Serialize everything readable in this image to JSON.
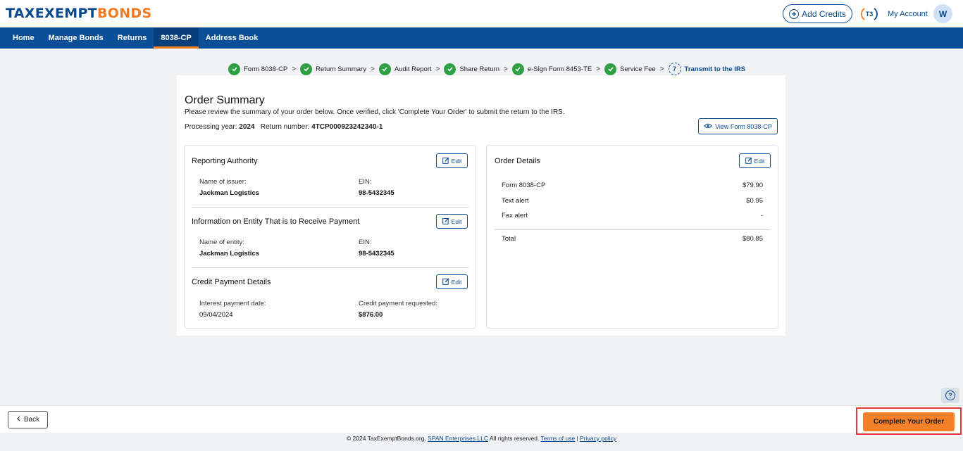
{
  "header": {
    "logo_part1": "TAXEXEMPT",
    "logo_part2": "B",
    "logo_part3": "ONDS",
    "add_credits_label": "Add Credits",
    "t3_label": "T3",
    "my_account_label": "My Account",
    "avatar_initial": "W"
  },
  "nav": {
    "items": [
      {
        "label": "Home"
      },
      {
        "label": "Manage Bonds"
      },
      {
        "label": "Returns"
      },
      {
        "label": "8038-CP"
      },
      {
        "label": "Address Book"
      }
    ]
  },
  "stepper": {
    "steps": [
      {
        "label": "Form 8038-CP",
        "status": "done"
      },
      {
        "label": "Return Summary",
        "status": "done"
      },
      {
        "label": "Audit Report",
        "status": "done"
      },
      {
        "label": "Share Return",
        "status": "done"
      },
      {
        "label": "e-Sign Form 8453-TE",
        "status": "done"
      },
      {
        "label": "Service Fee",
        "status": "done"
      },
      {
        "label": "Transmit to the IRS",
        "status": "current",
        "number": "7"
      }
    ]
  },
  "order": {
    "title": "Order Summary",
    "description": "Please review the summary of your order below. Once verified, click 'Complete Your Order' to submit the return to the IRS.",
    "processing_year_label": "Processing year:",
    "processing_year": "2024",
    "return_number_label": "Return number:",
    "return_number": "4TCP000923242340-1",
    "view_form_label": "View Form 8038-CP"
  },
  "left_panel": {
    "edit_label": "Edit",
    "reporting_authority": {
      "title": "Reporting Authority",
      "name_label": "Name of issuer:",
      "name_value": "Jackman Logistics",
      "ein_label": "EIN:",
      "ein_value": "98-5432345"
    },
    "entity": {
      "title": "Information on Entity That is to Receive Payment",
      "name_label": "Name of entity:",
      "name_value": "Jackman Logistics",
      "ein_label": "EIN:",
      "ein_value": "98-5432345"
    },
    "credit": {
      "title": "Credit Payment Details",
      "date_label": "Interest payment date:",
      "date_value": "09/04/2024",
      "amount_label": "Credit payment requested:",
      "amount_value": "$876.00"
    }
  },
  "right_panel": {
    "title": "Order Details",
    "edit_label": "Edit",
    "rows": [
      {
        "label": "Form 8038-CP",
        "value": "$79.90"
      },
      {
        "label": "Text alert",
        "value": "$0.95"
      },
      {
        "label": "Fax alert",
        "value": "-"
      }
    ],
    "total_label": "Total",
    "total_value": "$80.85"
  },
  "bottom": {
    "back_label": "Back",
    "complete_label": "Complete Your Order"
  },
  "footer": {
    "copyright": "© 2024 TaxExemptBonds.org,",
    "span_link": "SPAN Enterprises LLC",
    "rights": "All rights reserved.",
    "terms_link": "Terms of use",
    "divider": "|",
    "privacy_link": "Privacy policy"
  },
  "colors": {
    "brand_blue": "#0b4f98",
    "brand_orange": "#f27a21",
    "success_green": "#2ea043",
    "highlight_red": "#e03a3a"
  }
}
